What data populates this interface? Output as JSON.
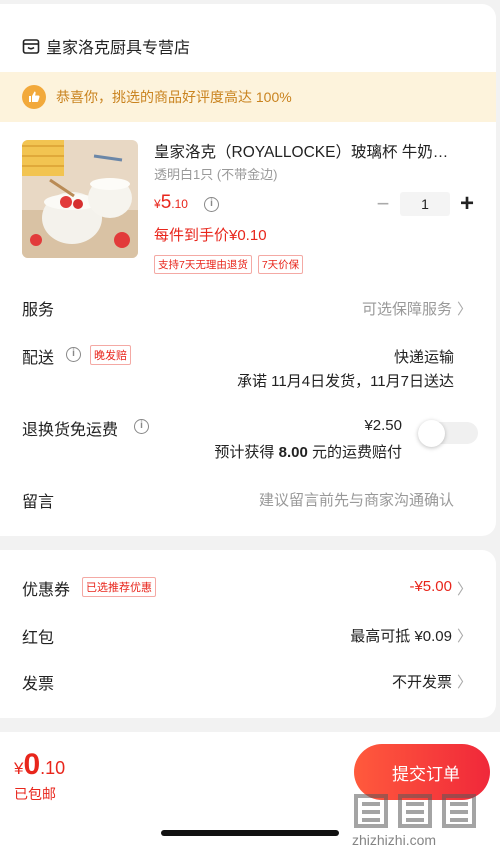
{
  "store": {
    "name": "皇家洛克厨具专营店",
    "icon": "store-icon"
  },
  "banner": {
    "text": "恭喜你，挑选的商品好评度高达 100%",
    "icon": "thumbs-up-icon",
    "color": "#c9831f"
  },
  "product": {
    "title": "皇家洛克（ROYALLOCKE）玻璃杯 牛奶…",
    "spec": "透明白1只 (不带金边)",
    "price_symbol": "¥",
    "price_int": "5",
    "price_dec": ".10",
    "quantity": "1",
    "final_price": "每件到手价¥0.10",
    "tags": [
      "支持7天无理由退货",
      "7天价保"
    ]
  },
  "rows": {
    "service": {
      "label": "服务",
      "value": "可选保障服务"
    },
    "delivery": {
      "label": "配送",
      "tag": "晚发赔",
      "method": "快递运输",
      "promise": "承诺 11月4日发货，11月7日送达"
    },
    "return_freight": {
      "label": "退换货免运费",
      "price": "¥2.50",
      "note_prefix": "预计获得",
      "note_amount": "8.00",
      "note_suffix": "元的运费赔付"
    },
    "message": {
      "label": "留言",
      "placeholder": "建议留言前先与商家沟通确认"
    }
  },
  "discounts": {
    "coupon": {
      "label": "优惠券",
      "tag": "已选推荐优惠",
      "value": "-¥5.00"
    },
    "red_packet": {
      "label": "红包",
      "value": "最高可抵 ¥0.09"
    },
    "invoice": {
      "label": "发票",
      "value": "不开发票"
    }
  },
  "footer": {
    "total_symbol": "¥",
    "total_int": "0",
    "total_dec": ".10",
    "shipping": "已包邮",
    "submit_label": "提交订单"
  },
  "watermark": {
    "text": "值 什么值得买",
    "url": "zhizhizhi.com"
  },
  "colors": {
    "accent": "#e8261c",
    "banner_bg": "#fdf3dc"
  }
}
